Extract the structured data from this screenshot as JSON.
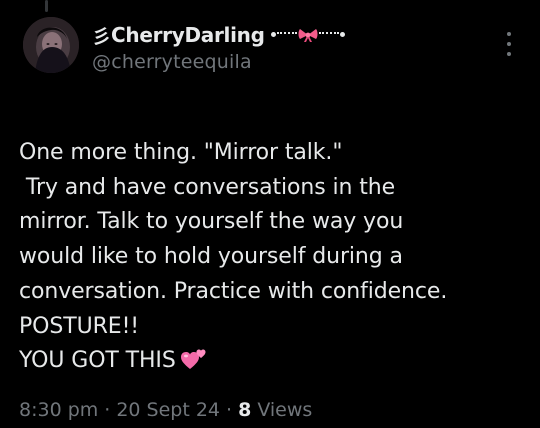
{
  "author": {
    "name_prefix": "彡",
    "display_name": "CherryDarling",
    "handle": "@cherryteequila"
  },
  "tweet": {
    "line_1": "One more thing. \"Mirror talk.\"",
    "line_2": " Try and have conversations in the",
    "line_3": "mirror. Talk to yourself the way you",
    "line_4": "would like to hold yourself during a",
    "line_5": "conversation. Practice with confidence.",
    "line_6": "POSTURE!!",
    "line_7": "YOU GOT THIS"
  },
  "meta": {
    "time": "8:30 pm",
    "separator": "·",
    "date": "20 Sept 24",
    "views_count": "8",
    "views_label": "Views"
  },
  "icons": {
    "avatar": "profile-photo",
    "bow": "pink-bow-icon",
    "more": "more-vertical-icon",
    "hearts": "two-hearts-icon"
  },
  "colors": {
    "background": "#000000",
    "text_primary": "#e7e9ea",
    "text_secondary": "#71767b",
    "bow_pink": "#f25b8a",
    "heart_pink": "#f46aa9"
  }
}
